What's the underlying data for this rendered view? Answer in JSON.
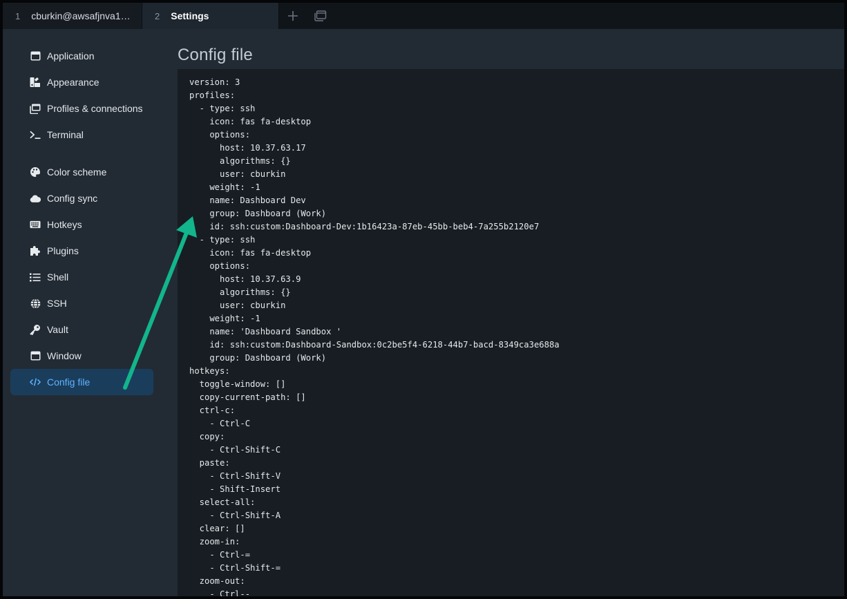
{
  "tabs": [
    {
      "number": "1",
      "title": "cburkin@awsafjnva10..."
    },
    {
      "number": "2",
      "title": "Settings"
    }
  ],
  "sidebar": {
    "items": [
      {
        "label": "Application",
        "icon": "window-icon"
      },
      {
        "label": "Appearance",
        "icon": "palette-brush-icon"
      },
      {
        "label": "Profiles & connections",
        "icon": "window-stack-icon"
      },
      {
        "label": "Terminal",
        "icon": "terminal-prompt-icon"
      },
      {
        "label": "Color scheme",
        "icon": "palette-icon"
      },
      {
        "label": "Config sync",
        "icon": "cloud-icon"
      },
      {
        "label": "Hotkeys",
        "icon": "keyboard-icon"
      },
      {
        "label": "Plugins",
        "icon": "puzzle-icon"
      },
      {
        "label": "Shell",
        "icon": "list-icon"
      },
      {
        "label": "SSH",
        "icon": "globe-icon"
      },
      {
        "label": "Vault",
        "icon": "key-icon"
      },
      {
        "label": "Window",
        "icon": "window-icon"
      },
      {
        "label": "Config file",
        "icon": "code-icon",
        "active": true
      }
    ]
  },
  "main": {
    "title": "Config file",
    "config_lines": [
      "version: 3",
      "profiles:",
      "  - type: ssh",
      "    icon: fas fa-desktop",
      "    options:",
      "      host: 10.37.63.17",
      "      algorithms: {}",
      "      user: cburkin",
      "    weight: -1",
      "    name: Dashboard Dev",
      "    group: Dashboard (Work)",
      "    id: ssh:custom:Dashboard-Dev:1b16423a-87eb-45bb-beb4-7a255b2120e7",
      "  - type: ssh",
      "    icon: fas fa-desktop",
      "    options:",
      "      host: 10.37.63.9",
      "      algorithms: {}",
      "      user: cburkin",
      "    weight: -1",
      "    name: 'Dashboard Sandbox '",
      "    id: ssh:custom:Dashboard-Sandbox:0c2be5f4-6218-44b7-bacd-8349ca3e688a",
      "    group: Dashboard (Work)",
      "hotkeys:",
      "  toggle-window: []",
      "  copy-current-path: []",
      "  ctrl-c:",
      "    - Ctrl-C",
      "  copy:",
      "    - Ctrl-Shift-C",
      "  paste:",
      "    - Ctrl-Shift-V",
      "    - Shift-Insert",
      "  select-all:",
      "    - Ctrl-Shift-A",
      "  clear: []",
      "  zoom-in:",
      "    - Ctrl-=",
      "    - Ctrl-Shift-=",
      "  zoom-out:",
      "    - Ctrl--"
    ]
  },
  "colors": {
    "accent": "#5fb3ff",
    "active_bg": "#1b3d5c",
    "annotation_arrow": "#12b58c"
  }
}
